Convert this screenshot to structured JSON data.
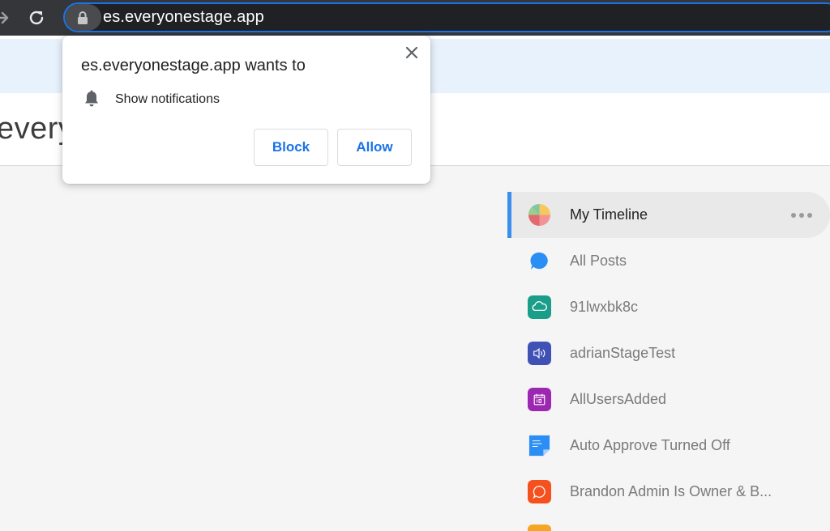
{
  "browser": {
    "url": "es.everyonestage.app"
  },
  "page": {
    "logo_text": "every"
  },
  "permission_popup": {
    "title": "es.everyonestage.app wants to",
    "permission": "Show notifications",
    "block_label": "Block",
    "allow_label": "Allow"
  },
  "nav": {
    "items": [
      {
        "label": "My Timeline",
        "icon": "pie-chart-icon",
        "active": true
      },
      {
        "label": "All Posts",
        "icon": "chat-bubble-icon"
      },
      {
        "label": "91lwxbk8c",
        "icon": "cloud-icon",
        "color": "#1a9e8a"
      },
      {
        "label": "adrianStageTest",
        "icon": "speaker-icon",
        "color": "#3f51b5"
      },
      {
        "label": "AllUsersAdded",
        "icon": "calendar-icon",
        "color": "#9c27b0"
      },
      {
        "label": "Auto Approve Turned Off",
        "icon": "sticky-note-icon",
        "color": "#2b8ef5"
      },
      {
        "label": "Brandon Admin Is Owner & B...",
        "icon": "chat-icon",
        "color": "#f4511e"
      }
    ]
  },
  "colors": {
    "accent": "#1a73e8",
    "active_indicator": "#3a8eed"
  }
}
